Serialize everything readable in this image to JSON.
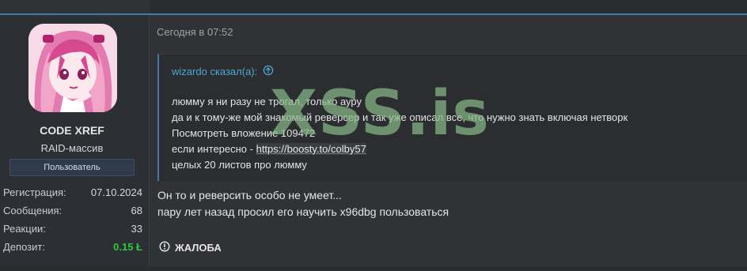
{
  "post": {
    "date": "Сегодня в 07:52",
    "report_label": "ЖАЛОБА"
  },
  "user": {
    "name": "CODE XREF",
    "title": "RAID-массив",
    "banner": "Пользователь",
    "stats": [
      {
        "label": "Регистрация:",
        "value": "07.10.2024"
      },
      {
        "label": "Сообщения:",
        "value": "68"
      },
      {
        "label": "Реакции:",
        "value": "33"
      },
      {
        "label": "Депозит:",
        "value": "0.15 Ł"
      }
    ]
  },
  "quote": {
    "author": "wizardo сказал(а):",
    "lines": [
      "люмму я ни разу не трогал, только ауру",
      "да и к тому-же мой знакомый реверсер и так уже описал все, что нужно знать включая нетворк",
      "Посмотреть вложение 109472"
    ],
    "link_prefix": "если интересно - ",
    "link_text": "https://boosty.to/colby57",
    "last_line": "целых 20 листов про люмму"
  },
  "message": {
    "lines": [
      "Он то и реверсить особо не умеет...",
      "пару лет назад просил его научить x96dbg пользоваться"
    ]
  },
  "watermark": "XSS.is",
  "colors": {
    "accent": "#3f7bb0",
    "quote_author": "#4fa9cf",
    "deposit": "#27c93f"
  }
}
